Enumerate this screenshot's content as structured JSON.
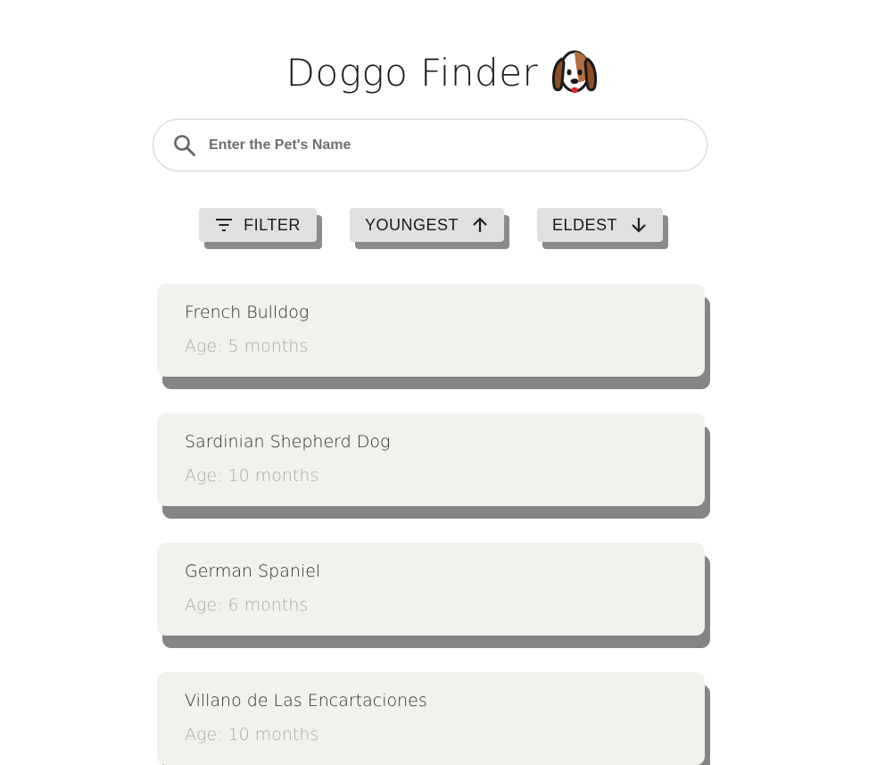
{
  "header": {
    "title": "Doggo Finder",
    "logo_icon": "dog-face-icon"
  },
  "search": {
    "placeholder": "Enter the Pet's Name",
    "value": "",
    "icon": "search-icon"
  },
  "sort_buttons": {
    "filter_label": "FILTER",
    "filter_icon": "filter-lines-icon",
    "youngest_label": "YOUNGEST",
    "youngest_icon": "arrow-up-icon",
    "eldest_label": "ELDEST",
    "eldest_icon": "arrow-down-icon"
  },
  "pets": [
    {
      "breed": "French Bulldog",
      "age": "Age: 5 months"
    },
    {
      "breed": "Sardinian Shepherd Dog",
      "age": "Age: 10 months"
    },
    {
      "breed": "German Spaniel",
      "age": "Age: 6 months"
    },
    {
      "breed": "Villano de Las Encartaciones",
      "age": "Age: 10 months"
    }
  ],
  "colors": {
    "card_background": "#f2f1ed",
    "card_shadow": "#858585",
    "button_background": "#e0e0e0",
    "button_shadow": "#8a8a8a",
    "age_text": "#a9a9a9"
  }
}
